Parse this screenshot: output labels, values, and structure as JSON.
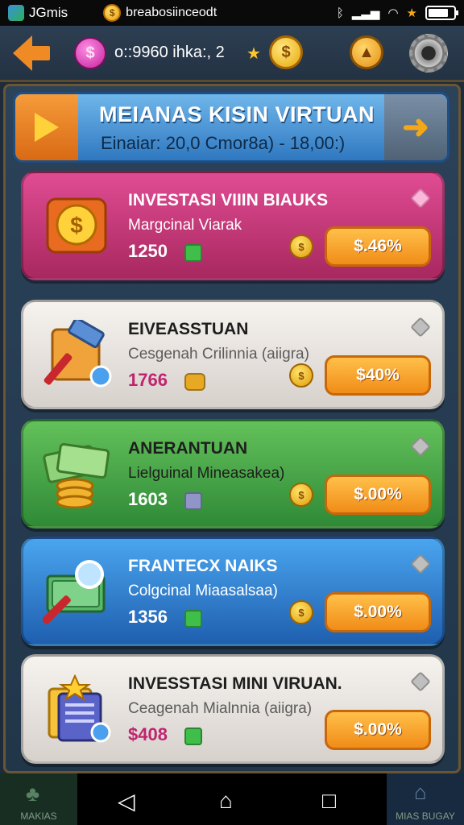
{
  "status_bar": {
    "app_title": "JGmis",
    "url_text": "breabosiinceodt"
  },
  "top_bar": {
    "gem_symbol": "$",
    "balance_text": "o::9960 ihka:, 2",
    "gold_symbol": "$"
  },
  "banner": {
    "title": "MEIANAS KISIN VIRTUAN",
    "subtitle": "Einaiar: 20,0 Cmor8a)  -   18,00:)"
  },
  "cards": [
    {
      "title": "INVESTASI VIIIN BIAUKS",
      "subtitle": "Margcinal Viarak",
      "price": "1250",
      "button_label": "$.46%",
      "cube_color": "#3fbf4a"
    },
    {
      "title": "EIVEASSTUAN",
      "subtitle": "Cesgenah Crilinnia (aiigra)",
      "price": "1766",
      "button_label": "$40%",
      "cube_color": "#e7a923"
    },
    {
      "title": "ANERANTUAN",
      "subtitle": "Lielguinal Mineasakea)",
      "price": "1603",
      "button_label": "$.00%",
      "cube_color": "#8f95c7"
    },
    {
      "title": "FRANTECX NAIKS",
      "subtitle": "Colgcinal Miaasalsaa)",
      "price": "1356",
      "button_label": "$.00%",
      "cube_color": "#3fbf4a"
    },
    {
      "title": "INVESSTASI MINI VIRUAN.",
      "subtitle": "Ceagenah Mialnnia (aiigra)",
      "price": "$408",
      "button_label": "$.00%",
      "cube_color": "#3fbf4a"
    }
  ],
  "nav": {
    "left_label": "MAKIAS",
    "right_label": "MIAS BUGAY"
  }
}
